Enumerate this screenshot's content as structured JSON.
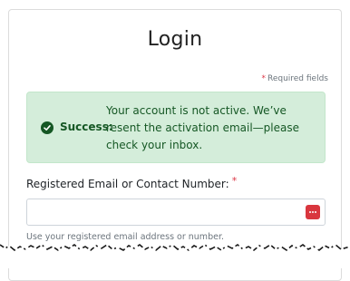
{
  "login": {
    "title": "Login",
    "required_note": "Required fields",
    "required_marker": "*"
  },
  "alert": {
    "label": "Success:",
    "message": "Your account is not active. We’ve resent the activation email—please check your inbox.",
    "color": "#d4edda",
    "text_color": "#155724",
    "icon": "check-circle-icon"
  },
  "field": {
    "label": "Registered Email or Contact Number:",
    "required_marker": "*",
    "value": "",
    "placeholder": "",
    "help_text": "Use your registered email address or number.",
    "trailing_icon": "password-manager-icon"
  },
  "colors": {
    "required_star": "#dc3545",
    "password_manager": "#d9363e"
  }
}
